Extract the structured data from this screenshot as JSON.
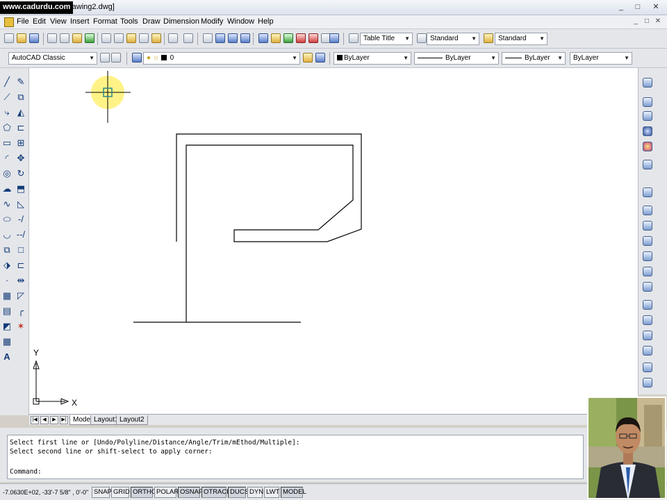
{
  "watermark": "www.cadurdu.com",
  "title_partial": "rawing2.dwg]",
  "window_controls": [
    "_",
    "□",
    "✕"
  ],
  "mdi_controls": [
    "_",
    "□",
    "✕"
  ],
  "menu": [
    "File",
    "Edit",
    "View",
    "Insert",
    "Format",
    "Tools",
    "Draw",
    "Dimension",
    "Modify",
    "Window",
    "Help"
  ],
  "toolbar_styles": {
    "table_style": "Table Title",
    "text_style": "Standard",
    "dim_style": "Standard"
  },
  "toolbar_layers": {
    "workspace": "AutoCAD Classic",
    "current_layer": "0",
    "color": "ByLayer",
    "linetype": "ByLayer",
    "lineweight": "ByLayer",
    "plotstyle": "ByLayer"
  },
  "ucs": {
    "y_label": "Y",
    "x_label": "X"
  },
  "layout_tabs": [
    "Model",
    "Layout1",
    "Layout2"
  ],
  "command_lines": [
    "Select first line or [Undo/Polyline/Distance/Angle/Trim/mEthod/Multiple]:",
    "Select second line or shift-select to apply corner:"
  ],
  "command_prompt": "Command:",
  "status": {
    "coordinates": "-7.0630E+02, -33'-7 5/8\" , 0'-0\"",
    "toggles": [
      {
        "label": "SNAP",
        "on": false
      },
      {
        "label": "GRID",
        "on": false
      },
      {
        "label": "ORTHO",
        "on": true
      },
      {
        "label": "POLAR",
        "on": false
      },
      {
        "label": "OSNAP",
        "on": true
      },
      {
        "label": "OTRACK",
        "on": true
      },
      {
        "label": "DUCS",
        "on": true
      },
      {
        "label": "DYN",
        "on": false
      },
      {
        "label": "LWT",
        "on": false
      },
      {
        "label": "MODEL",
        "on": true
      }
    ]
  },
  "icons": [
    "line-icon",
    "polyline-icon",
    "circle-icon",
    "arc-icon",
    "rectangle-icon",
    "erase-icon",
    "copy-icon",
    "mirror-icon",
    "offset-icon",
    "array-icon",
    "move-icon",
    "rotate-icon",
    "scale-icon",
    "trim-icon",
    "fillet-icon",
    "text-icon"
  ],
  "colors": {
    "canvas": "#ffffff",
    "cursor_highlight": "#fff27a",
    "ui_face": "#e4e6ea"
  }
}
